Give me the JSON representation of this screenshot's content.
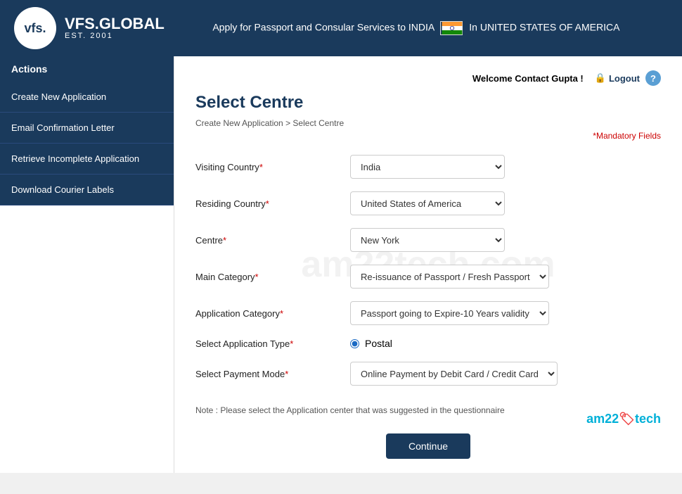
{
  "header": {
    "logo_vfs": "vfs.",
    "logo_est": "EST. 2001",
    "logo_name": "VFS.GLOBAL",
    "tagline": "Apply for Passport and Consular Services to INDIA",
    "location": "In UNITED STATES OF AMERICA"
  },
  "topbar": {
    "welcome": "Welcome Contact Gupta !",
    "logout": "Logout",
    "help": "?"
  },
  "page": {
    "title": "Select Centre",
    "breadcrumb_part1": "Create New Application",
    "breadcrumb_separator": " > ",
    "breadcrumb_part2": "Select Centre",
    "mandatory_note": "*Mandatory Fields"
  },
  "sidebar": {
    "actions_header": "Actions",
    "items": [
      {
        "label": "Create New Application"
      },
      {
        "label": "Email Confirmation Letter"
      },
      {
        "label": "Retrieve Incomplete Application"
      },
      {
        "label": "Download Courier Labels"
      }
    ]
  },
  "form": {
    "visiting_country_label": "Visiting Country",
    "visiting_country_value": "India",
    "residing_country_label": "Residing Country",
    "residing_country_value": "United States of America",
    "centre_label": "Centre",
    "centre_value": "New York",
    "main_category_label": "Main Category",
    "main_category_value": "Re-issuance of Passport / Fresh Passport",
    "app_category_label": "Application Category",
    "app_category_value": "Passport going to Expire-10 Years validity",
    "app_type_label": "Select Application Type",
    "app_type_value": "Postal",
    "payment_mode_label": "Select Payment Mode",
    "payment_mode_value": "Online Payment by Debit Card / Credit Card",
    "note": "Note : Please select the Application center that was suggested in the questionnaire",
    "continue_button": "Continue"
  },
  "watermark": "am22tech.com",
  "am22tech_brand": "am22"
}
